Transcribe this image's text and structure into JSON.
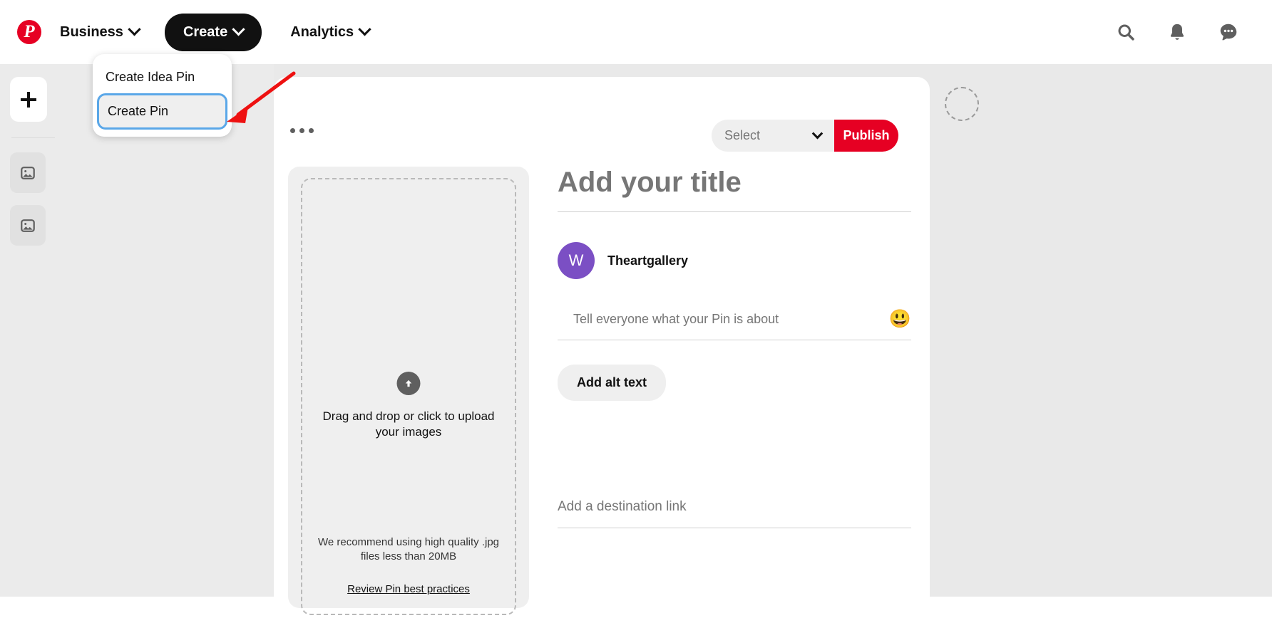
{
  "topbar": {
    "logo_icon": "pinterest-logo-icon",
    "logo_letter": "P",
    "business_label": "Business",
    "create_label": "Create",
    "analytics_label": "Analytics",
    "search_icon": "search-icon",
    "notifications_icon": "bell-icon",
    "messages_icon": "chat-bubble-icon",
    "chevron_icon": "chevron-down-icon"
  },
  "create_dropdown": {
    "items": [
      {
        "label": "Create Idea Pin",
        "highlighted": false
      },
      {
        "label": "Create Pin",
        "highlighted": true
      }
    ]
  },
  "annotation": {
    "type": "red-arrow",
    "color": "#ee1111",
    "points_to": "Create Pin"
  },
  "sidebar": {
    "add_icon": "plus-icon",
    "thumbnails": [
      {
        "icon": "image-placeholder-icon"
      },
      {
        "icon": "image-placeholder-icon"
      }
    ]
  },
  "editor": {
    "overflow_icon": "ellipsis-icon",
    "board_select": {
      "value": "Select",
      "chevron_icon": "chevron-down-icon"
    },
    "publish_label": "Publish",
    "publish_color": "#e60023",
    "upload": {
      "icon": "upload-arrow-icon",
      "drop_text": "Drag and drop or click to upload your images",
      "note": "We recommend using high quality .jpg files less than 20MB",
      "link": "Review Pin best practices"
    },
    "title_placeholder": "Add your title",
    "author": {
      "avatar_letter": "W",
      "avatar_color": "#7b4fc4",
      "name": "Theartgallery"
    },
    "description_placeholder": "Tell everyone what your Pin is about",
    "emoji_icon": "😃",
    "alt_text_label": "Add alt text",
    "destination_placeholder": "Add a destination link"
  },
  "right_panel": {
    "placeholder_icon": "dashed-circle-placeholder"
  }
}
